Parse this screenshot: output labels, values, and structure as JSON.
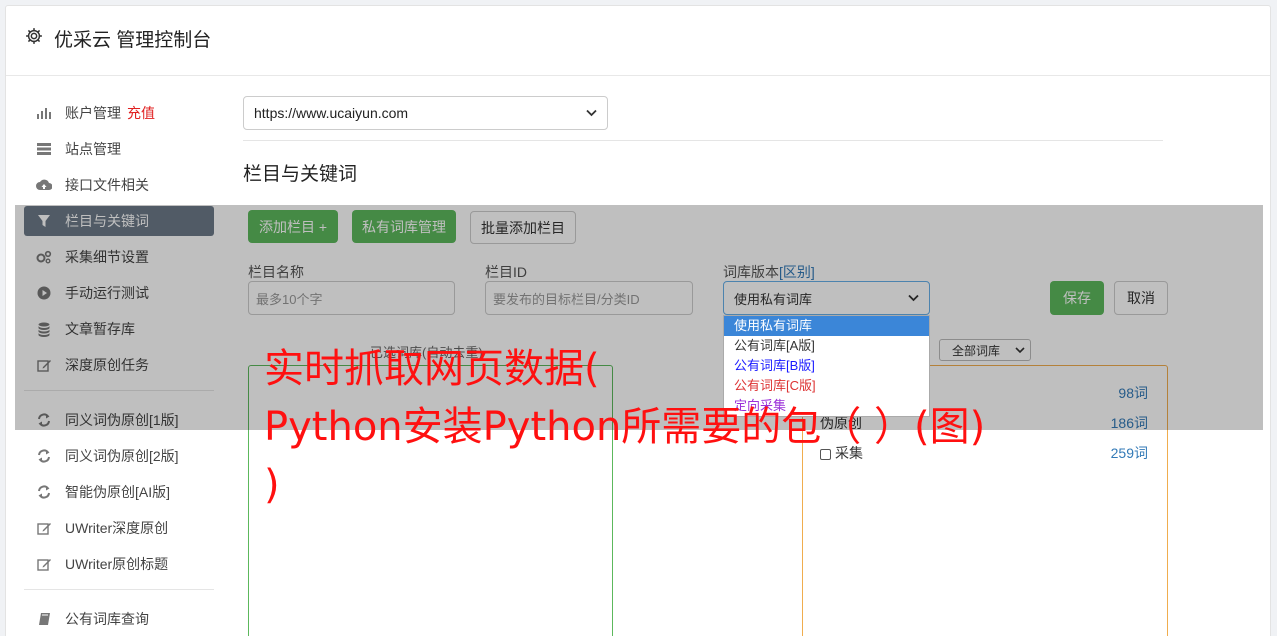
{
  "header": {
    "title": "优采云 管理控制台",
    "icon": "gear-icon"
  },
  "sidebar": {
    "items": [
      {
        "label": "账户管理",
        "badge": "充值",
        "icon": "bar-chart-icon"
      },
      {
        "label": "站点管理",
        "icon": "server-icon"
      },
      {
        "label": "接口文件相关",
        "icon": "cloud-upload-icon"
      },
      {
        "label": "栏目与关键词",
        "icon": "filter-icon",
        "active": true
      },
      {
        "label": "采集细节设置",
        "icon": "gears-icon"
      },
      {
        "label": "手动运行测试",
        "icon": "play-icon"
      },
      {
        "label": "文章暂存库",
        "icon": "database-icon"
      },
      {
        "label": "深度原创任务",
        "icon": "edit-icon"
      }
    ],
    "items2": [
      {
        "label": "同义词伪原创[1版]",
        "icon": "refresh-icon"
      },
      {
        "label": "同义词伪原创[2版]",
        "icon": "refresh-icon"
      },
      {
        "label": "智能伪原创[AI版]",
        "icon": "refresh-icon"
      },
      {
        "label": "UWriter深度原创",
        "icon": "edit-icon"
      },
      {
        "label": "UWriter原创标题",
        "icon": "edit-icon"
      }
    ],
    "items3": [
      {
        "label": "公有词库查询",
        "icon": "book-icon"
      }
    ]
  },
  "main": {
    "site_select": {
      "value": "https://www.ucaiyun.com"
    },
    "section_title": "栏目与关键词",
    "buttons": {
      "add_column": "添加栏目 +",
      "private_lib": "私有词库管理",
      "batch_add": "批量添加栏目",
      "save": "保存",
      "cancel": "取消"
    },
    "form": {
      "name_label": "栏目名称",
      "name_placeholder": "最多10个字",
      "id_label": "栏目ID",
      "id_placeholder": "要发布的目标栏目/分类ID",
      "lib_label": "词库版本",
      "lib_label_link": "[区别]",
      "lib_value": "使用私有词库",
      "lib_options": [
        "使用私有词库",
        "公有词库[A版]",
        "公有词库[B版]",
        "公有词库[C版]",
        "定向采集"
      ]
    },
    "selected_caption": "已选词库(自动去重)",
    "all_lib_select": "全部词库",
    "lib_rows": [
      {
        "label": "",
        "count": "98词"
      },
      {
        "label": "伪原创",
        "count": "186词"
      },
      {
        "label": "采集",
        "count": "259词"
      }
    ]
  },
  "watermark": {
    "line1": "实时抓取网页数据(",
    "line2": "Python安装Python所需要的包（ ）(图)",
    "line3": ")"
  },
  "colors": {
    "active_nav": "#6c7a89",
    "green": "#5cb85c",
    "orange": "#f0ad4e",
    "watermark": "#ff1010"
  }
}
